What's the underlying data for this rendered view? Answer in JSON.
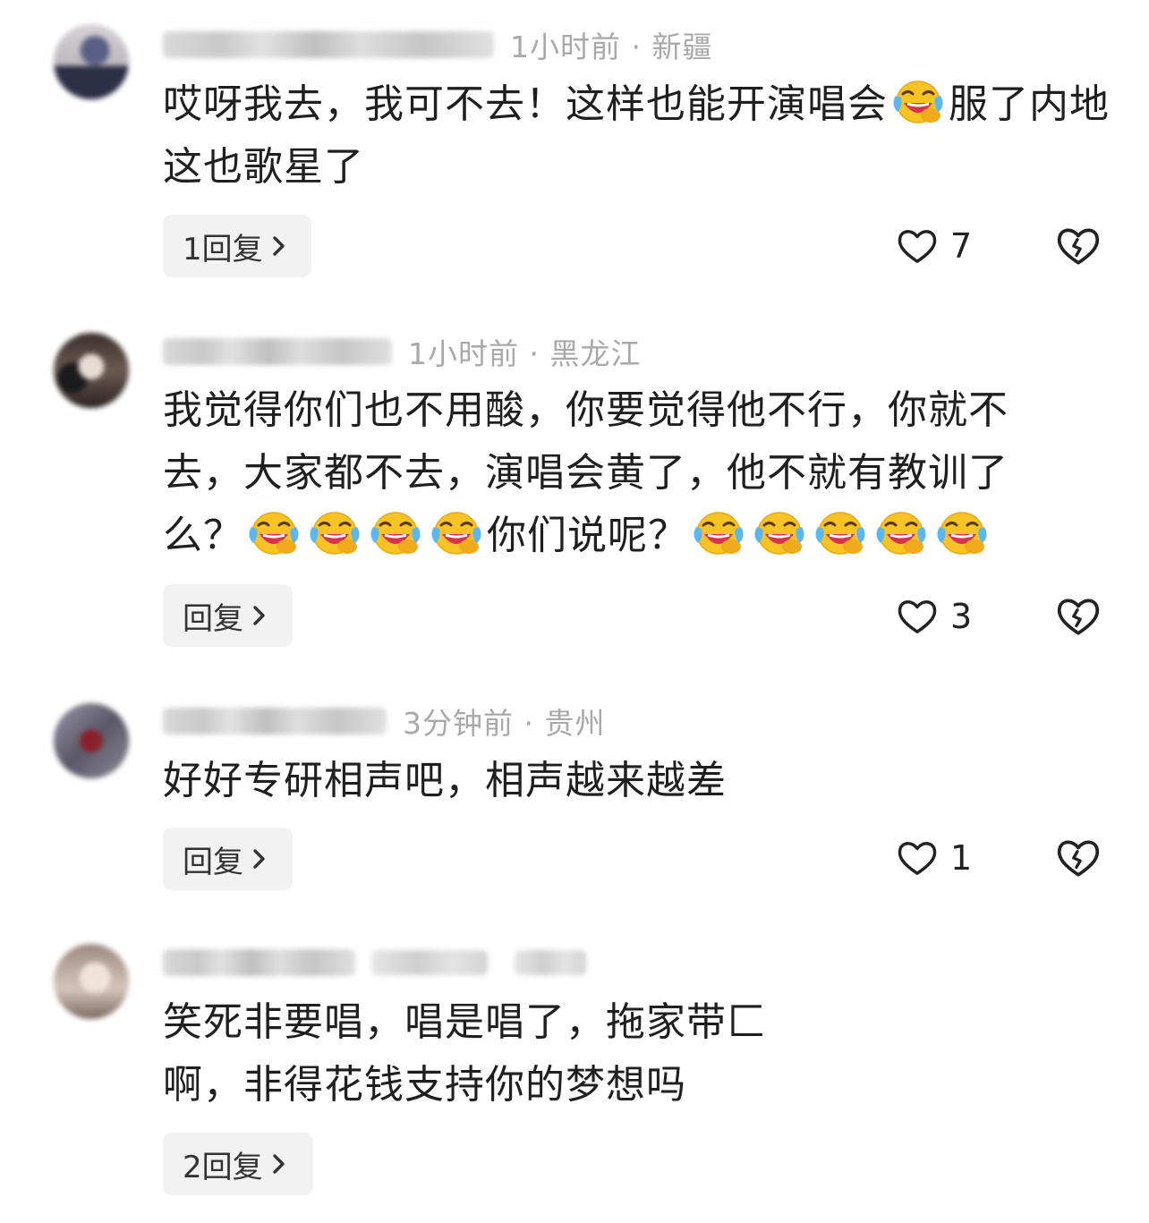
{
  "comments": [
    {
      "meta": "1小时前 · 新疆",
      "text": "哎呀我去，我可不去！这样也能开演唱会",
      "text_after_emoji": "服了内地这也歌星了",
      "reply_label": "1回复",
      "likes": "7"
    },
    {
      "meta": "1小时前 · 黑龙江",
      "line1": "我觉得你们也不用酸，你要觉得他不行，你就不",
      "line2": "去，大家都不去，演唱会黄了，他不就有教训了",
      "line3_a": "么？",
      "line3_b": "你们说呢？",
      "reply_label": "回复",
      "likes": "3"
    },
    {
      "meta": "3分钟前 · 贵州",
      "text": "好好专研相声吧，相声越来越差",
      "reply_label": "回复",
      "likes": "1"
    },
    {
      "line1": "笑死非要唱，唱是唱了，拖家带匚",
      "line2": "啊，非得花钱支持你的梦想吗",
      "reply_label": "2回复"
    }
  ],
  "icons": {
    "emoji": "laughing-crying-emoji-icon",
    "like": "heart-outline-icon",
    "dislike": "broken-heart-icon",
    "chevron": "chevron-right-icon"
  },
  "colors": {
    "meta": "#a9a9a9",
    "reply_bg": "#f2f2f2",
    "text": "#1f1f1f"
  }
}
